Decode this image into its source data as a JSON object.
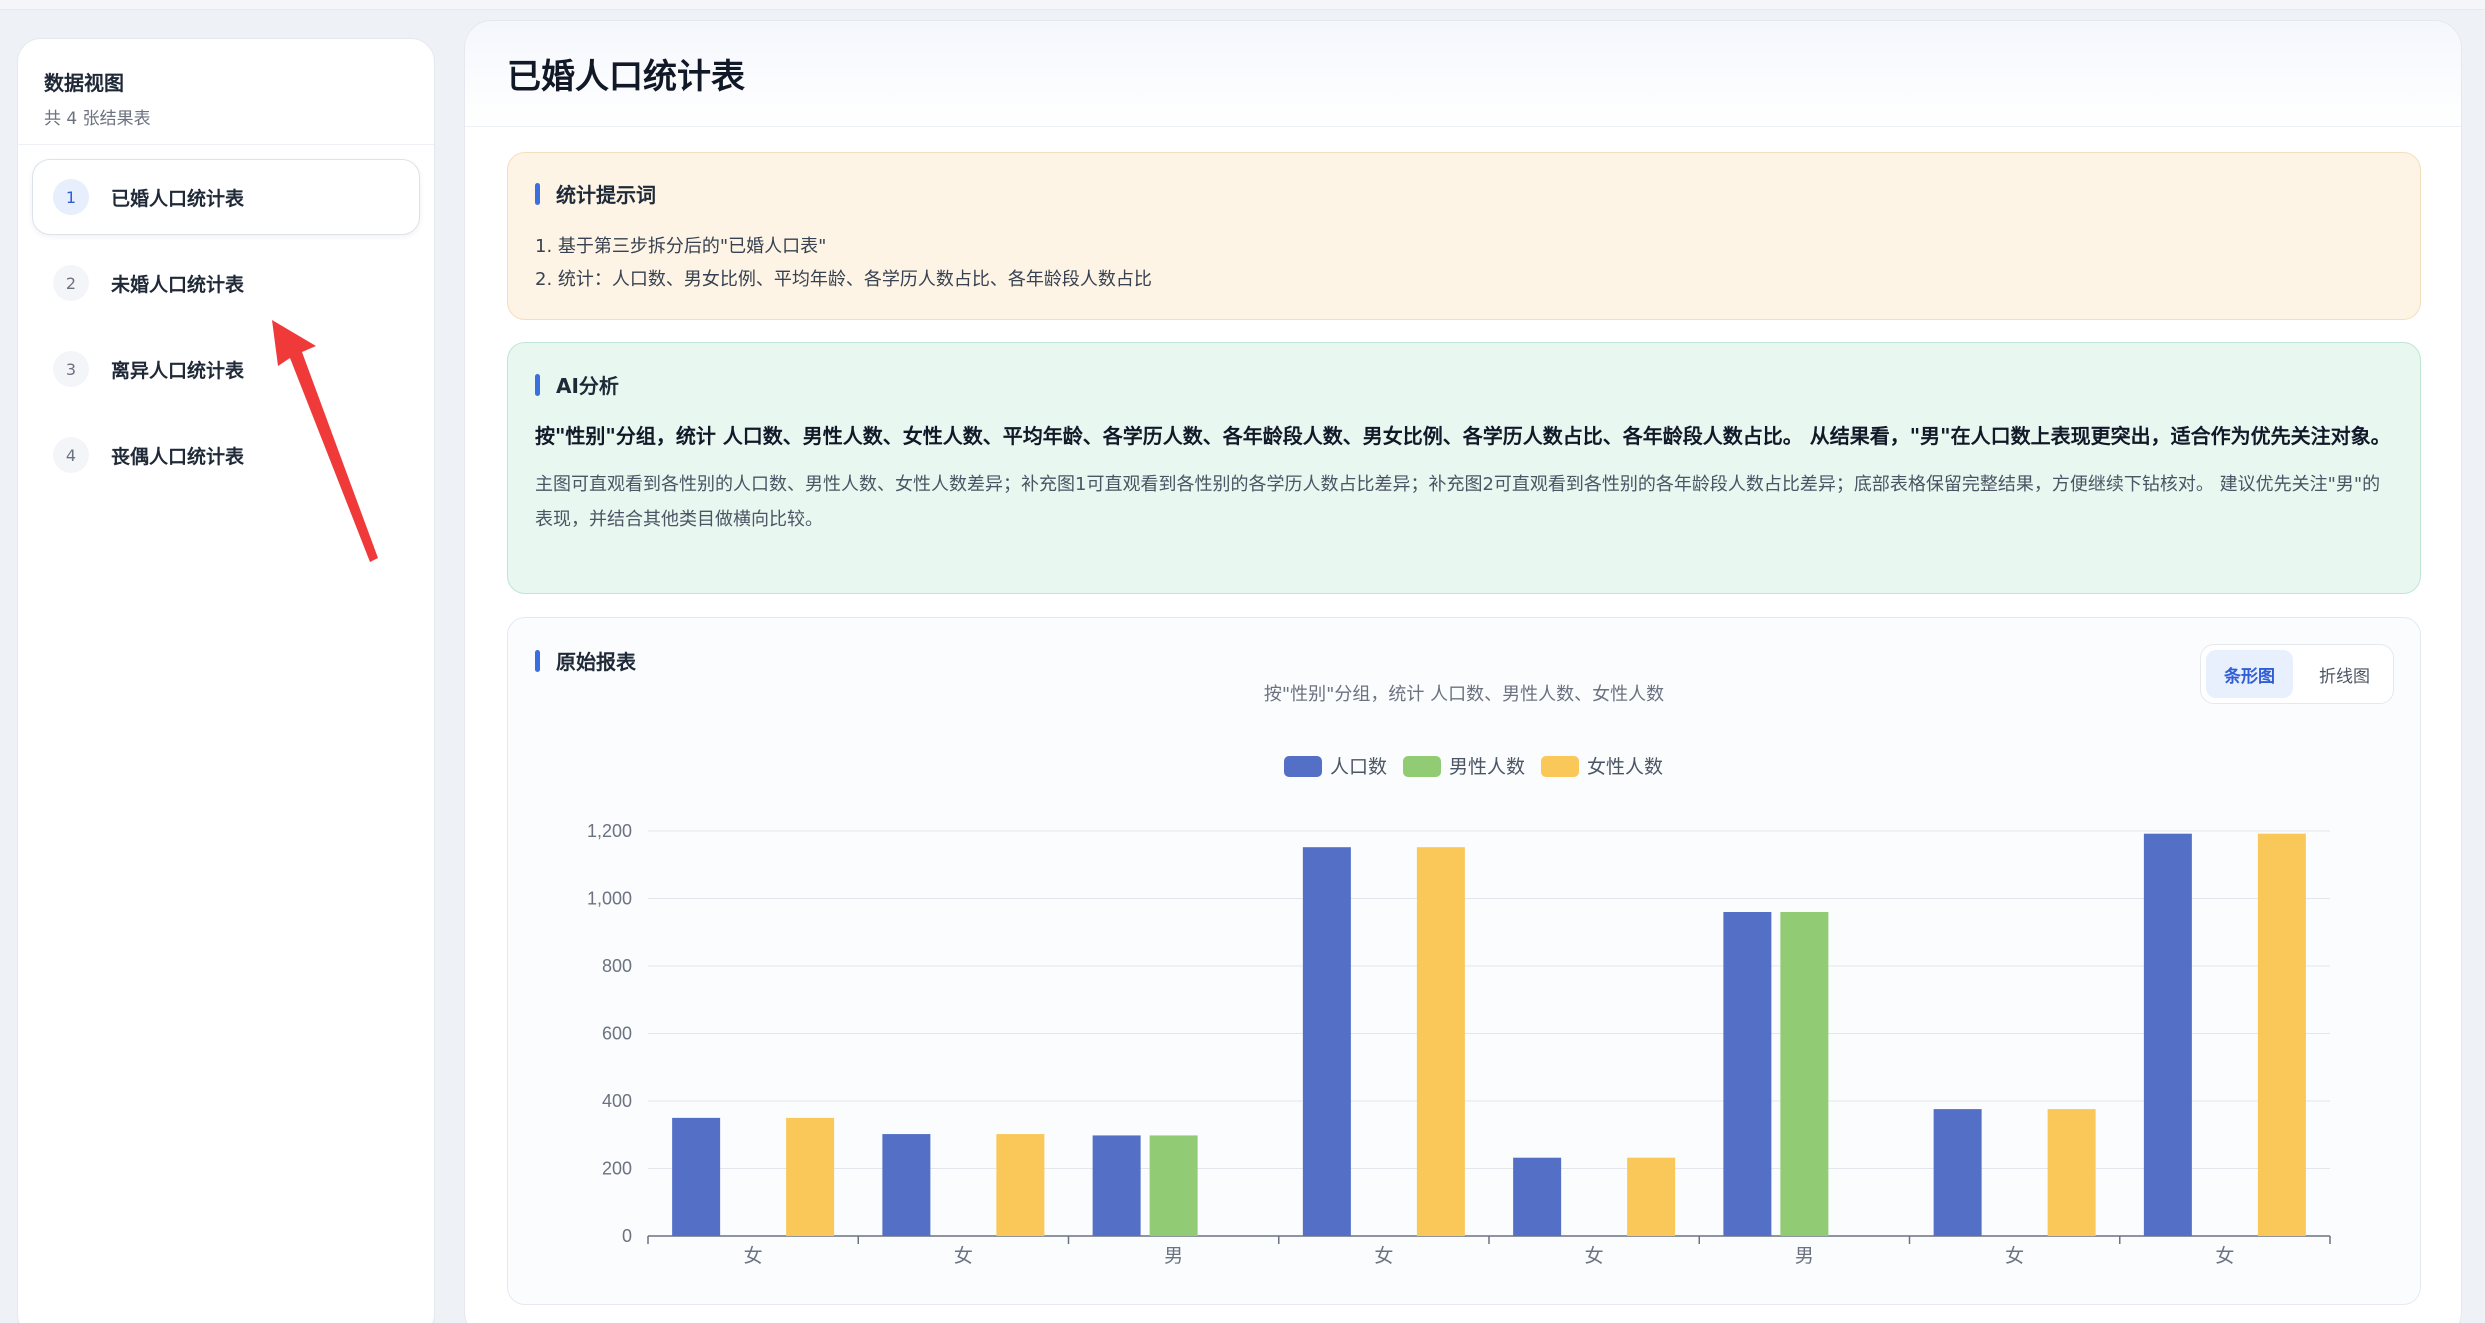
{
  "sidebar": {
    "title": "数据视图",
    "subtitle": "共 4 张结果表",
    "items": [
      {
        "num": "1",
        "label": "已婚人口统计表"
      },
      {
        "num": "2",
        "label": "未婚人口统计表"
      },
      {
        "num": "3",
        "label": "离异人口统计表"
      },
      {
        "num": "4",
        "label": "丧偶人口统计表"
      }
    ]
  },
  "main": {
    "title": "已婚人口统计表",
    "prompt": {
      "title": "统计提示词",
      "line1": "1. 基于第三步拆分后的\"已婚人口表\"",
      "line2": "2. 统计：人口数、男女比例、平均年龄、各学历人数占比、各年龄段人数占比"
    },
    "ai": {
      "title": "AI分析",
      "summary": "按\"性别\"分组，统计 人口数、男性人数、女性人数、平均年龄、各学历人数、各年龄段人数、男女比例、各学历人数占比、各年龄段人数占比。 从结果看，\"男\"在人口数上表现更突出，适合作为优先关注对象。",
      "detail": "主图可直观看到各性别的人口数、男性人数、女性人数差异；补充图1可直观看到各性别的各学历人数占比差异；补充图2可直观看到各性别的各年龄段人数占比差异；底部表格保留完整结果，方便继续下钻核对。 建议优先关注\"男\"的表现，并结合其他类目做横向比较。"
    },
    "report": {
      "title": "原始报表",
      "subtitle": "按\"性别\"分组，统计 人口数、男性人数、女性人数",
      "toggle": {
        "bar": "条形图",
        "line": "折线图"
      }
    }
  },
  "chart_data": {
    "type": "bar",
    "title": "按\"性别\"分组，统计 人口数、男性人数、女性人数",
    "categories": [
      "女",
      "女",
      "男",
      "女",
      "女",
      "男",
      "女",
      "女"
    ],
    "series": [
      {
        "name": "人口数",
        "color": "#5470c6",
        "values": [
          350,
          302,
          298,
          1152,
          232,
          960,
          376,
          1192
        ]
      },
      {
        "name": "男性人数",
        "color": "#91cc75",
        "values": [
          0,
          0,
          298,
          0,
          0,
          960,
          0,
          0
        ]
      },
      {
        "name": "女性人数",
        "color": "#fac858",
        "values": [
          350,
          302,
          0,
          1152,
          232,
          0,
          376,
          1192
        ]
      }
    ],
    "yticks": [
      "0",
      "200",
      "400",
      "600",
      "800",
      "1,000",
      "1,200"
    ],
    "ylim": [
      0,
      1200
    ],
    "legend_position": "top-center",
    "grid": true
  }
}
